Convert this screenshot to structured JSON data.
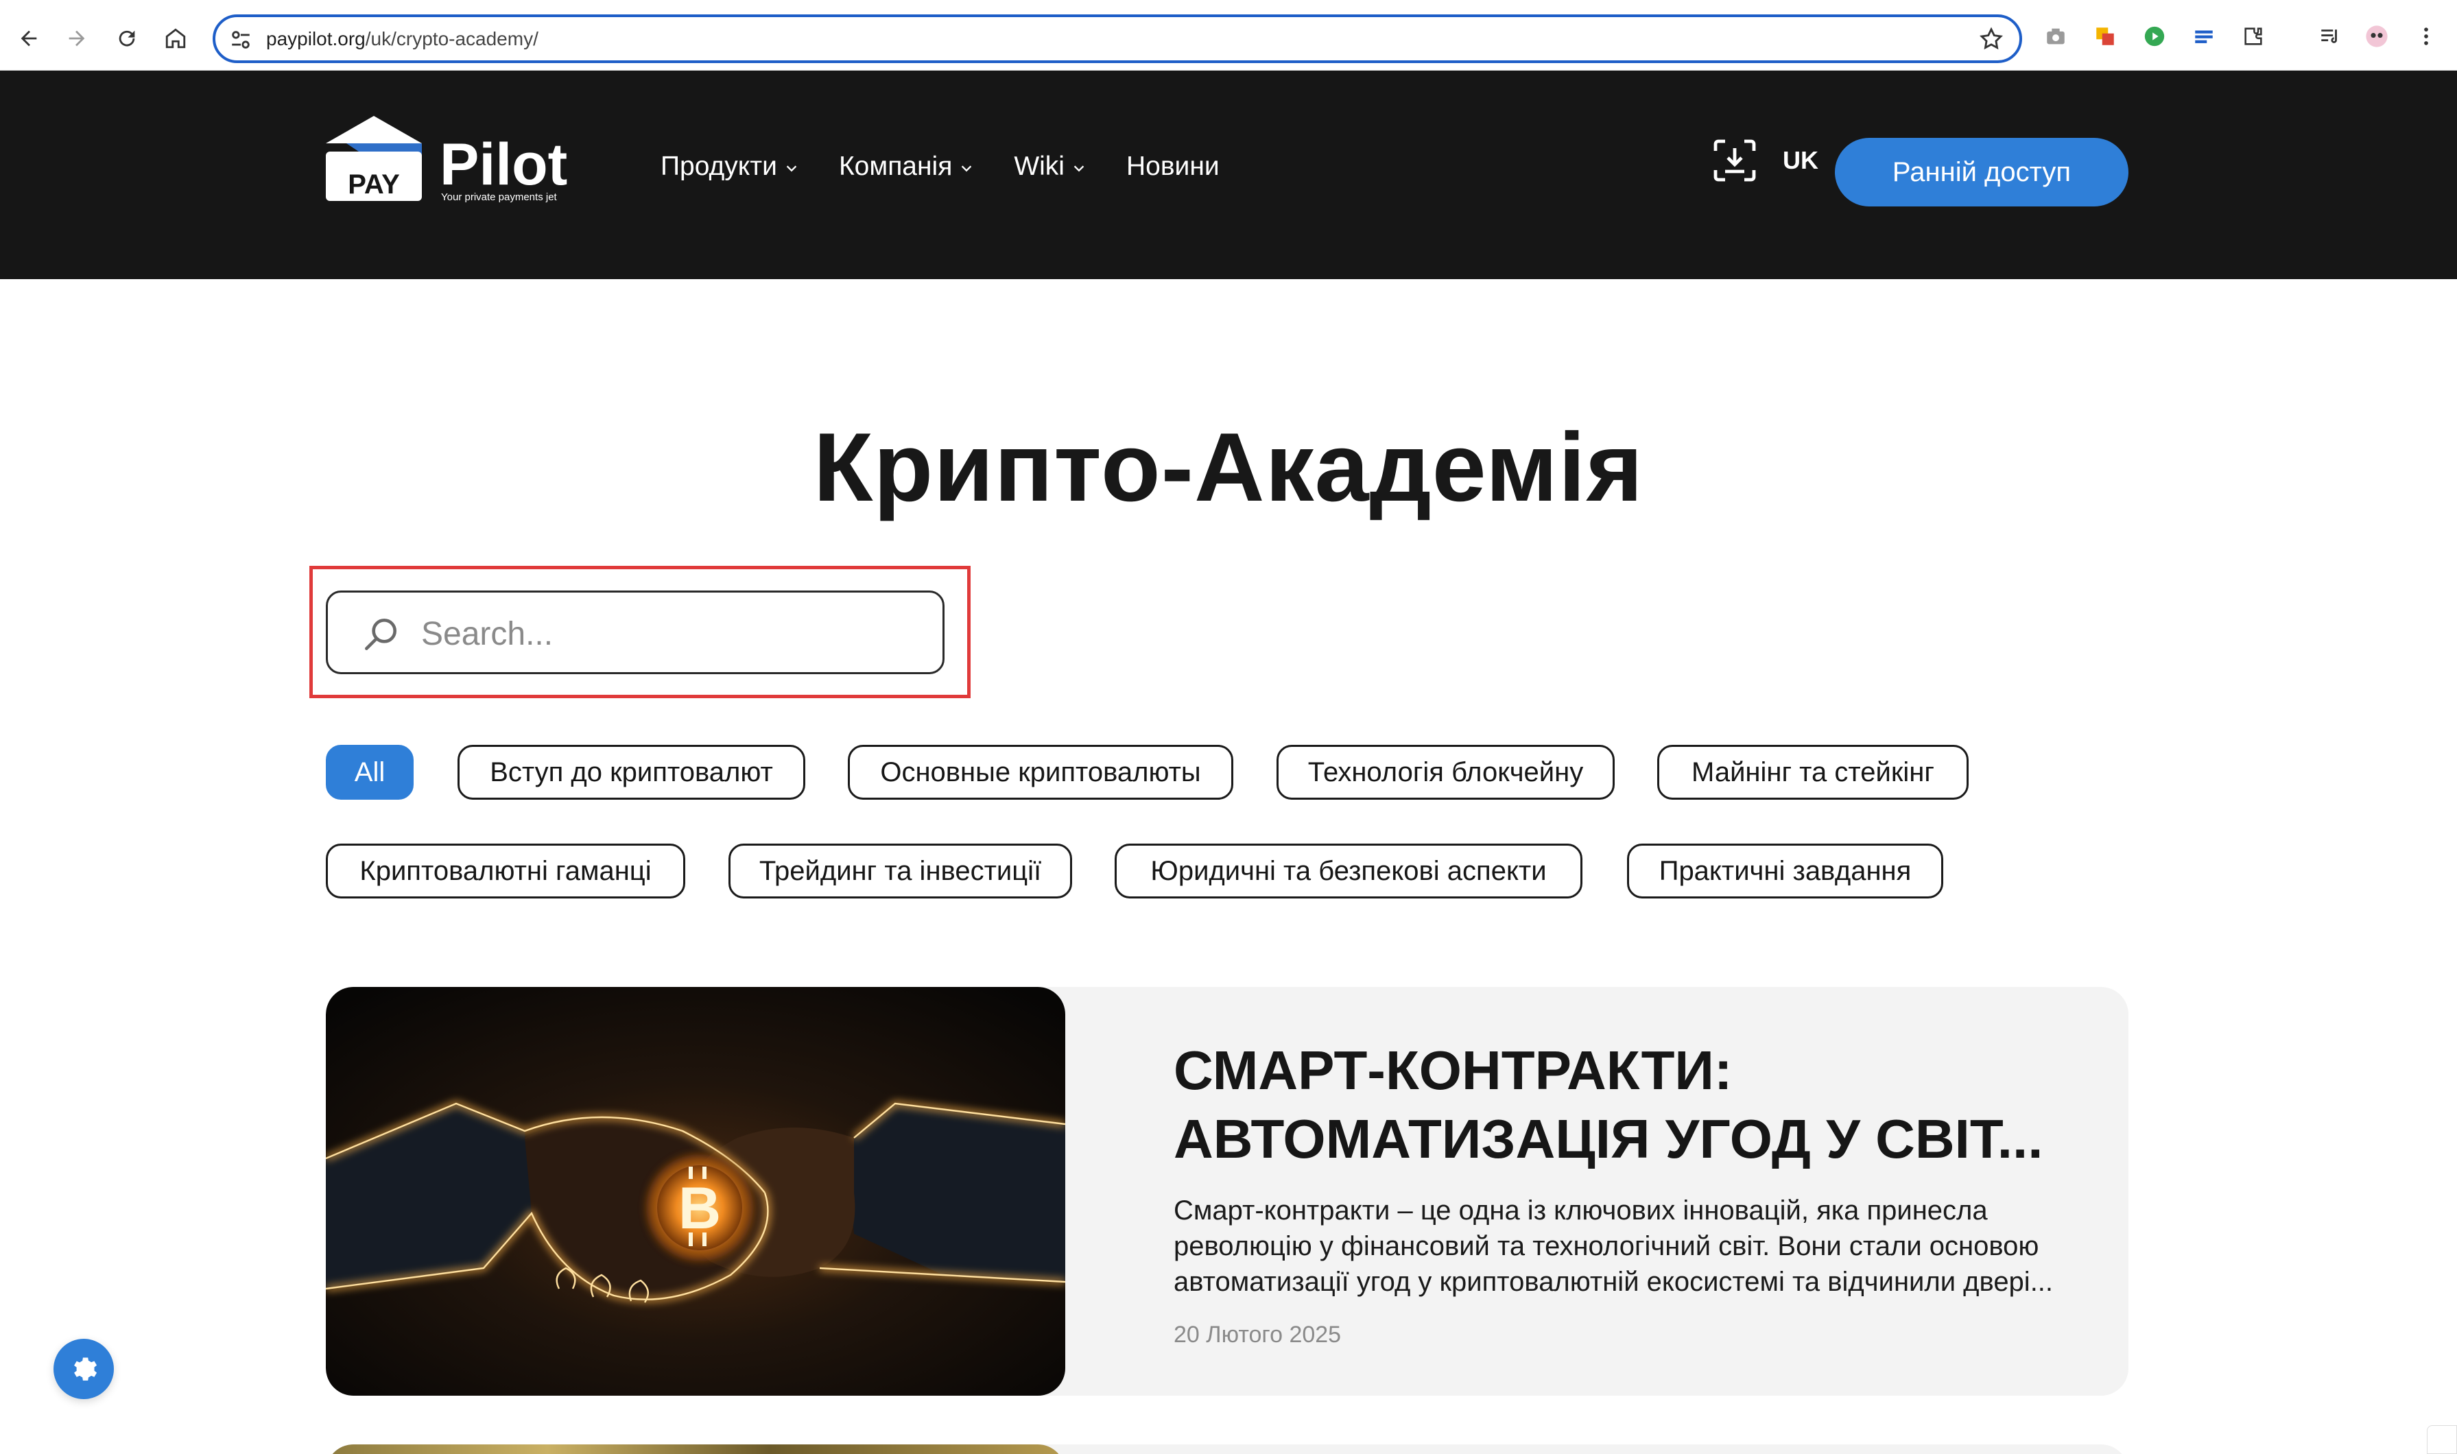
{
  "browser": {
    "url_host": "paypilot.org",
    "url_path": "/uk/crypto-academy/",
    "icons": [
      "back-icon",
      "forward-icon",
      "reload-icon",
      "home-icon",
      "site-settings-icon",
      "bookmark-star-icon",
      "camera-icon",
      "extension-icon",
      "extensions-puzzle-icon",
      "media-icon",
      "profile-avatar-icon",
      "more-menu-icon"
    ]
  },
  "header": {
    "logo": {
      "pay": "PAY",
      "pilot": "Pilot",
      "tagline": "Your private payments jet"
    },
    "nav": [
      {
        "label": "Продукти",
        "has_dropdown": true
      },
      {
        "label": "Компанія",
        "has_dropdown": true
      },
      {
        "label": "Wiki",
        "has_dropdown": true
      },
      {
        "label": "Новини",
        "has_dropdown": false
      }
    ],
    "lang": "UK",
    "cta": "Ранній доступ"
  },
  "page": {
    "title": "Крипто-Академія",
    "search_placeholder": "Search...",
    "search_value": ""
  },
  "filters": [
    {
      "label": "All",
      "active": true
    },
    {
      "label": "Вступ до криптовалют",
      "active": false
    },
    {
      "label": "Основные криптовалюты",
      "active": false
    },
    {
      "label": "Технологія блокчейну",
      "active": false
    },
    {
      "label": "Майнінг та стейкінг",
      "active": false
    },
    {
      "label": "Криптовалютні гаманці",
      "active": false
    },
    {
      "label": "Трейдинг та інвестиції",
      "active": false
    },
    {
      "label": "Юридичні та безпекові аспекти",
      "active": false
    },
    {
      "label": "Практичні завдання",
      "active": false
    }
  ],
  "articles": [
    {
      "title": "Смарт-контракти: автоматизація угод у світ...",
      "excerpt": "Смарт-контракти – це одна із ключових інновацій, яка принесла революцію у фінансовий та технологічний світ. Вони стали основою автоматизації угод у криптовалютній екосистемі та відчинили двері...",
      "date": "20 Лютого 2025"
    }
  ],
  "colors": {
    "accent": "#2f7fd8",
    "header_bg": "#161616",
    "card_bg": "#f3f3f3",
    "highlight": "#e03a3a"
  }
}
